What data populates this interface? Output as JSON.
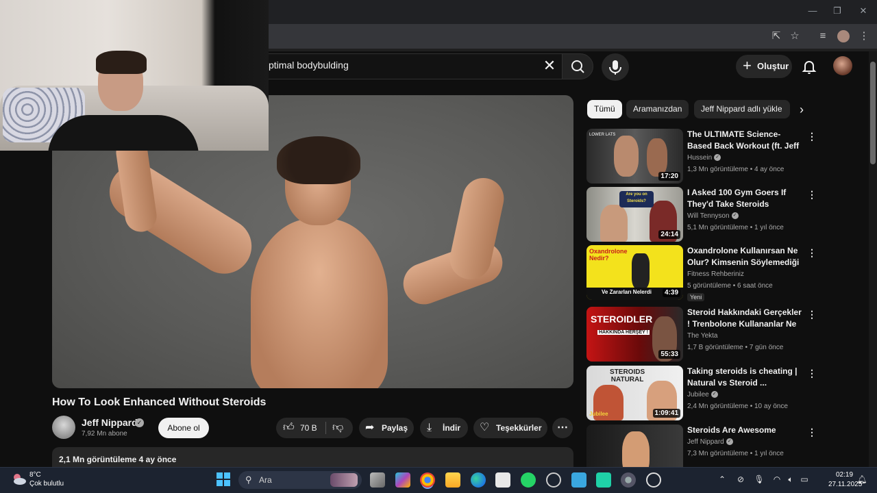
{
  "search": {
    "query": "ptimal bodybulding"
  },
  "header": {
    "create_label": "Oluştur"
  },
  "video": {
    "title": "How To Look Enhanced Without Steroids",
    "channel": "Jeff Nippard",
    "subscribers": "7,92 Mn abone",
    "subscribe_label": "Abone ol",
    "likes": "70 B",
    "share_label": "Paylaş",
    "download_label": "İndir",
    "thanks_label": "Teşekkürler",
    "description_meta": "2,1 Mn görüntüleme  4 ay önce"
  },
  "chips": [
    "Tümü",
    "Aramanızdan",
    "Jeff Nippard adlı yükle"
  ],
  "related": [
    {
      "title": "The ULTIMATE Science-Based Back Workout (ft. Jeff Nippar...",
      "channel": "Hussein",
      "verified": true,
      "views": "1,3 Mn görüntüleme • 4 ay önce",
      "duration": "17:20",
      "badge": ""
    },
    {
      "title": "I Asked 100 Gym Goers If They'd Take Steroids",
      "channel": "Will Tennyson",
      "verified": true,
      "views": "5,1 Mn görüntüleme • 1 yıl önce",
      "duration": "24:14",
      "badge": ""
    },
    {
      "title": "Oxandrolone Kullanırsan Ne Olur? Kimsenin Söylemediği ...",
      "channel": "Fitness Rehberiniz",
      "verified": false,
      "views": "5 görüntüleme • 6 saat önce",
      "duration": "4:39",
      "badge": "Yeni"
    },
    {
      "title": "Steroid Hakkındaki Gerçekler ! Trenbolone Kullananlar Ne ...",
      "channel": "The Yekta",
      "verified": false,
      "views": "1,7 B görüntüleme • 7 gün önce",
      "duration": "55:33",
      "badge": ""
    },
    {
      "title": "Taking steroids is cheating | Natural vs Steroid ...",
      "channel": "Jubilee",
      "verified": true,
      "views": "2,4 Mn görüntüleme • 10 ay önce",
      "duration": "1:09:41",
      "badge": ""
    },
    {
      "title": "Steroids Are Awesome",
      "channel": "Jeff Nippard",
      "verified": true,
      "views": "7,3 Mn görüntüleme • 1 yıl önce",
      "duration": "",
      "badge": ""
    }
  ],
  "thumbnails": {
    "t1": "LOWER LATS",
    "t2a": "Are you on",
    "t2b": "Steroids?",
    "t3a": "Oxandrolone",
    "t3b": "Nedir?",
    "t3c": "Ve Zararları Nelerdi",
    "t4a": "STEROIDLER",
    "t4b": "HAKKINDA HERŞEY !",
    "t5a": "STEROIDS",
    "t5b": "NATURAL",
    "t5c": "Jubilee"
  },
  "taskbar": {
    "temp": "8°C",
    "weather": "Çok bulutlu",
    "search_placeholder": "Ara",
    "time": "02:19",
    "date": "27.11.2025"
  },
  "colors": {
    "bg": "#0f0f0f",
    "pill": "#272727",
    "text": "#f1f1f1",
    "muted": "#aaaaaa"
  }
}
